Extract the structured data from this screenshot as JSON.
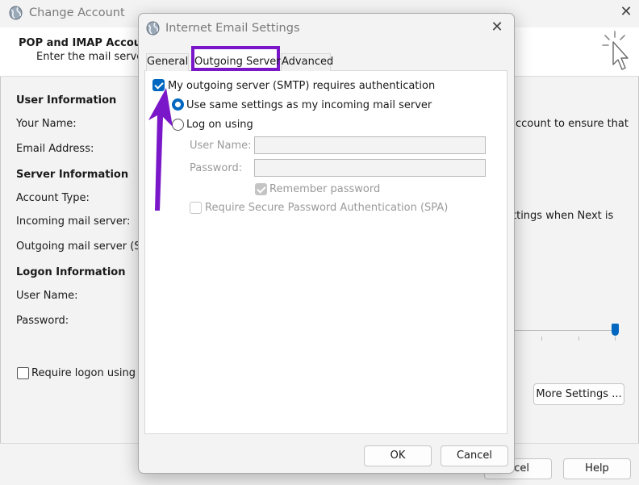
{
  "background_window": {
    "title": "Change Account",
    "heading": "POP and IMAP Account",
    "subheading": "Enter the mail server s",
    "sections": {
      "user_information": "User Information",
      "server_information": "Server Information",
      "logon_information": "Logon Information"
    },
    "labels": {
      "your_name": "Your Name:",
      "email_address": "Email Address:",
      "account_type": "Account Type:",
      "incoming_server": "Incoming mail server:",
      "outgoing_server": "Outgoing mail server (SMT",
      "user_name": "User Name:",
      "password": "Password:"
    },
    "right_text": {
      "line1": "ccount to ensure that",
      "line2": "ttings when Next is"
    },
    "require_logon_label": "Require logon using Se",
    "more_settings_label": "More Settings ...",
    "cancel_label": "ncel",
    "help_label": "Help"
  },
  "dialog": {
    "title": "Internet Email Settings",
    "tabs": [
      {
        "label": "General",
        "active": false
      },
      {
        "label": "Outgoing Server",
        "active": true
      },
      {
        "label": "Advanced",
        "active": false
      }
    ],
    "smtp_auth": {
      "label": "My outgoing server (SMTP) requires authentication",
      "checked": true
    },
    "radio_same": {
      "label": "Use same settings as my incoming mail server",
      "selected": true
    },
    "radio_logon": {
      "label": "Log on using",
      "selected": false
    },
    "username_label": "User Name:",
    "username_value": "",
    "password_label": "Password:",
    "password_value": "",
    "remember_password": {
      "label": "Remember password",
      "checked": true,
      "disabled": true
    },
    "spa": {
      "label": "Require Secure Password Authentication (SPA)",
      "checked": false,
      "disabled": true
    },
    "ok_label": "OK",
    "cancel_label": "Cancel"
  },
  "annotations": {
    "highlight_color": "#7a18c9",
    "arrow_color": "#7a18c9"
  },
  "colors": {
    "accent": "#0067c0",
    "window_bg": "#f3f3f3",
    "panel_bg": "#ffffff",
    "disabled_text": "#9a9a9a"
  },
  "icons": {
    "app_icon": "globe-icon",
    "close": "close-icon",
    "cursor": "cursor-icon"
  }
}
